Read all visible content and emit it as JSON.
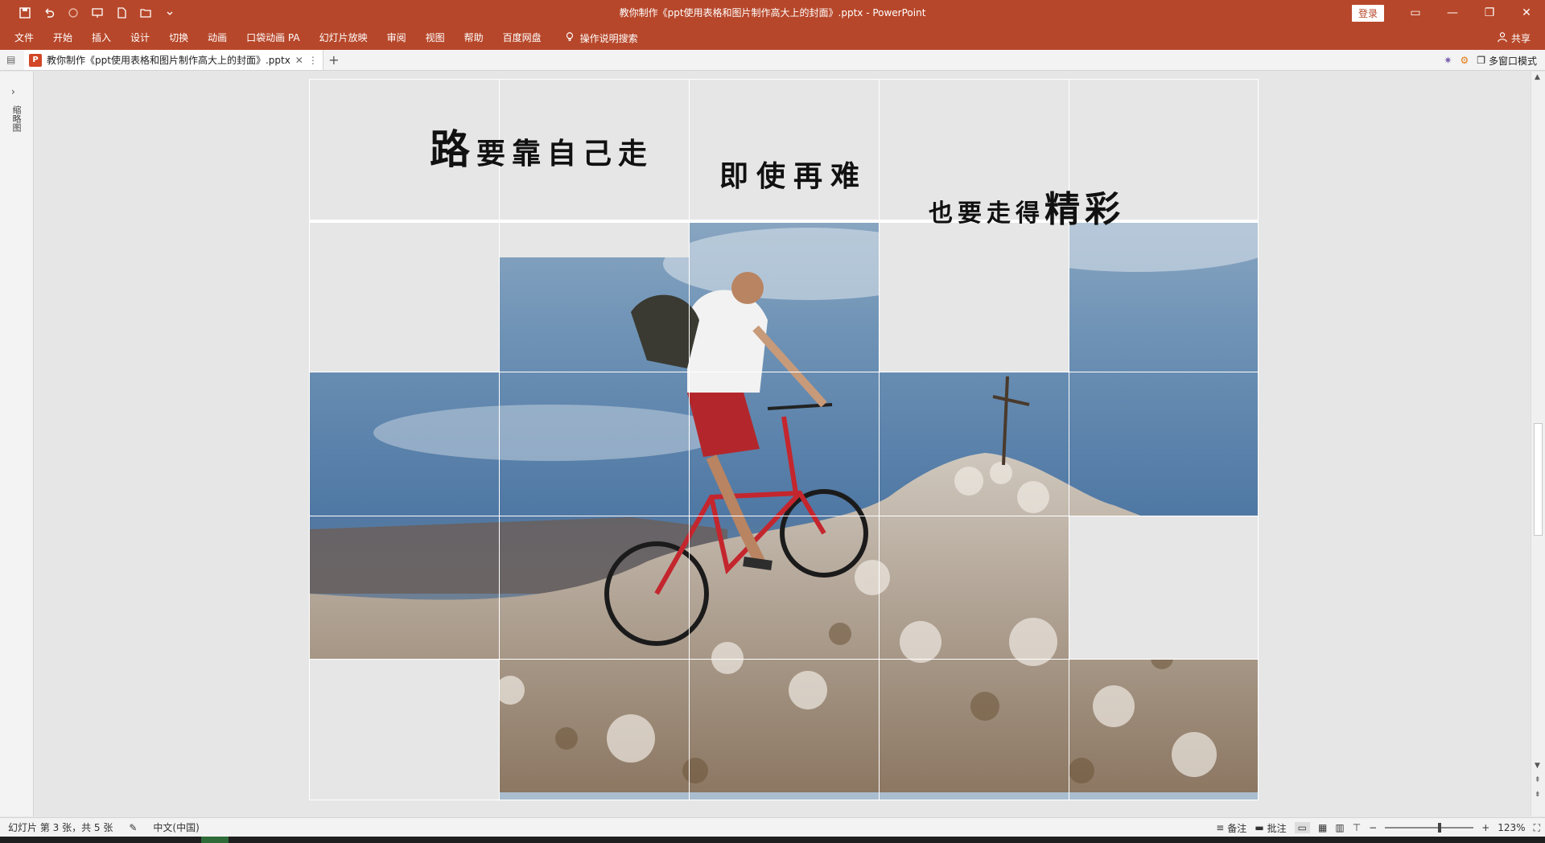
{
  "window": {
    "title": "教你制作《ppt使用表格和图片制作高大上的封面》.pptx  -  PowerPoint",
    "login_label": "登录"
  },
  "ribbon": {
    "tabs": [
      "文件",
      "开始",
      "插入",
      "设计",
      "切换",
      "动画",
      "口袋动画 PA",
      "幻灯片放映",
      "审阅",
      "视图",
      "帮助",
      "百度网盘"
    ],
    "tell_me": "操作说明搜索",
    "share": "共享"
  },
  "doc_tabs": {
    "active_title": "教你制作《ppt使用表格和图片制作高大上的封面》.pptx",
    "multi_window": "多窗口模式"
  },
  "left_pane": {
    "label": "缩略图"
  },
  "slide": {
    "line1_big": "路",
    "line1_rest": "要靠自己走",
    "line2": "即使再难",
    "line3_rest": "也要走得",
    "line3_big": "精彩"
  },
  "status": {
    "slide_info": "幻灯片 第 3 张，共 5 张",
    "language": "中文(中国)",
    "notes": "备注",
    "comments": "批注",
    "zoom": "123%"
  },
  "colors": {
    "accent": "#b7472a"
  }
}
